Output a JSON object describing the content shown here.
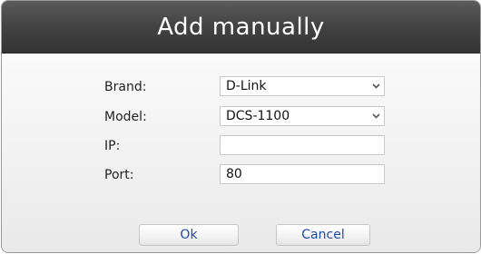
{
  "dialog": {
    "title": "Add manually"
  },
  "form": {
    "brand_label": "Brand:",
    "brand_value": "D-Link",
    "model_label": "Model:",
    "model_value": "DCS-1100",
    "ip_label": "IP:",
    "ip_value": "",
    "port_label": "Port:",
    "port_value": "80"
  },
  "buttons": {
    "ok_label": "Ok",
    "cancel_label": "Cancel"
  },
  "colors": {
    "title_bar": "#3a3a3a",
    "button_text": "#1f4aa8"
  },
  "icons": {
    "dropdown": "chevron-down-icon"
  }
}
